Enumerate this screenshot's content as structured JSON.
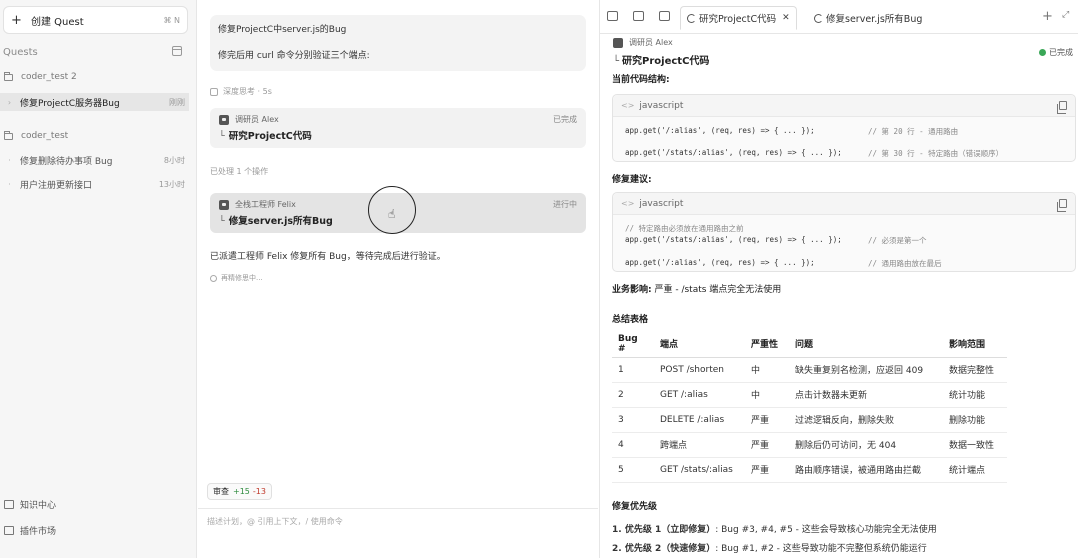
{
  "sidebar": {
    "new_quest_label": "创建 Quest",
    "new_quest_shortcut": "⌘ N",
    "quests_title": "Quests",
    "groups": [
      {
        "folder": "coder_test 2",
        "items": [
          {
            "label": "修复ProjectC服务器Bug",
            "time": "刚刚",
            "active": true
          }
        ]
      },
      {
        "folder": "coder_test",
        "items": [
          {
            "label": "修复删除待办事项 Bug",
            "time": "8小时"
          },
          {
            "label": "用户注册更新接口",
            "time": "13小时"
          }
        ]
      }
    ],
    "footer": {
      "knowledge": "知识中心",
      "plugins": "插件市场"
    }
  },
  "chat": {
    "user_message_line1": "修复ProjectC中server.js的Bug",
    "user_message_line2": "修完后用 curl 命令分别验证三个端点:",
    "thinking_label": "深度思考 · 5s",
    "agent_cards": [
      {
        "role": "调研员 Alex",
        "task": "研究ProjectC代码",
        "status": "已完成"
      },
      {
        "role": "全栈工程师 Felix",
        "task": "修复server.js所有Bug",
        "status": "进行中"
      }
    ],
    "handled_label": "已处理 1 个操作",
    "done_message": "已派遣工程师 Felix 修复所有 Bug，等待完成后进行验证。",
    "thinking2_label": "再精修思中...",
    "diff": {
      "label": "审查",
      "plus": "+15",
      "minus": "-13"
    },
    "input_placeholder": "描述计划，@ 引用上下文，/ 使用命令"
  },
  "right": {
    "tabs": [
      {
        "label": "研究ProjectC代码",
        "active": true,
        "close": "✕"
      },
      {
        "label": "修复server.js所有Bug",
        "active": false
      }
    ],
    "header": {
      "role": "调研员 Alex",
      "task": "研究ProjectC代码",
      "status": "已完成"
    },
    "partial_heading": "当前代码结构:",
    "code1": {
      "lang": "javascript",
      "lines": [
        {
          "code": "app.get('/:alias', (req, res) => { ... });",
          "comment": "// 第 20 行 - 通用路由"
        },
        {
          "code": "app.get('/stats/:alias', (req, res) => { ... });",
          "comment": "// 第 30 行 - 特定路由（错误顺序）"
        }
      ]
    },
    "fix_heading": "修复建议:",
    "code2": {
      "lang": "javascript",
      "comment_line": "// 特定路由必须放在通用路由之前",
      "lines": [
        {
          "code": "app.get('/stats/:alias', (req, res) => { ... });",
          "comment": "// 必须是第一个"
        },
        {
          "code": "app.get('/:alias', (req, res) => { ... });",
          "comment": "// 通用路由放在最后"
        }
      ]
    },
    "impact_label": "业务影响:",
    "impact_text": "严重 - /stats 端点完全无法使用",
    "summary_heading": "总结表格",
    "table": {
      "headers": [
        "Bug #",
        "端点",
        "严重性",
        "问题",
        "影响范围"
      ],
      "rows": [
        [
          "1",
          "POST /shorten",
          "中",
          "缺失重复别名检测，应返回 409",
          "数据完整性"
        ],
        [
          "2",
          "GET /:alias",
          "中",
          "点击计数器未更新",
          "统计功能"
        ],
        [
          "3",
          "DELETE /:alias",
          "严重",
          "过滤逻辑反向，删除失败",
          "删除功能"
        ],
        [
          "4",
          "跨端点",
          "严重",
          "删除后仍可访问，无 404",
          "数据一致性"
        ],
        [
          "5",
          "GET /stats/:alias",
          "严重",
          "路由顺序错误，被通用路由拦截",
          "统计端点"
        ]
      ]
    },
    "priority_heading": "修复优先级",
    "priorities": [
      {
        "tag": "1. 优先级 1（立即修复）",
        "text": ": Bug #3, #4, #5 - 这些会导致核心功能完全无法使用"
      },
      {
        "tag": "2. 优先级 2（快速修复）",
        "text": ": Bug #1, #2 - 这些导致功能不完整但系统仍能运行"
      }
    ]
  }
}
